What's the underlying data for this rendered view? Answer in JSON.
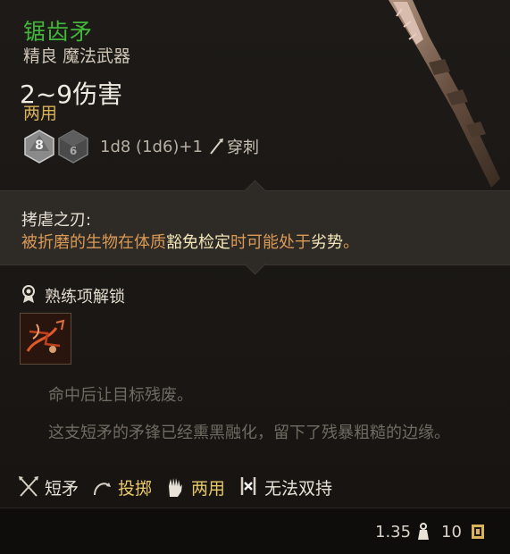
{
  "item": {
    "name": "锯齿矛",
    "rarity_type": "精良 魔法武器",
    "damage": "2~9伤害",
    "handedness": "两用",
    "dice": {
      "die1": "8",
      "die2": "6",
      "formula": "1d8 (1d6)+1",
      "damage_type": "穿刺"
    }
  },
  "passive": {
    "name": "拷虐之刃:",
    "desc_pre": "被折磨的生物在体质",
    "desc_highlight": "豁免检定",
    "desc_mid": "时可能处于",
    "desc_highlight2": "劣势",
    "desc_post": "。"
  },
  "proficiency": {
    "title": "熟练项解锁"
  },
  "description": {
    "effect": "命中后让目标残废。",
    "flavor": "这支短矛的矛锋已经熏黑融化，留下了残暴粗糙的边缘。"
  },
  "tags": [
    {
      "label": "短矛",
      "icon": "crossed-spears-icon"
    },
    {
      "label": "投掷",
      "icon": "throw-icon"
    },
    {
      "label": "两用",
      "icon": "hand-icon"
    },
    {
      "label": "无法双持",
      "icon": "no-dual-wield-icon"
    }
  ],
  "footer": {
    "weight": "1.35",
    "price": "10"
  },
  "colors": {
    "name": "#41b63a",
    "gold": "#d9b25a",
    "orange_text": "#d99a57",
    "background": "#1a1714"
  }
}
